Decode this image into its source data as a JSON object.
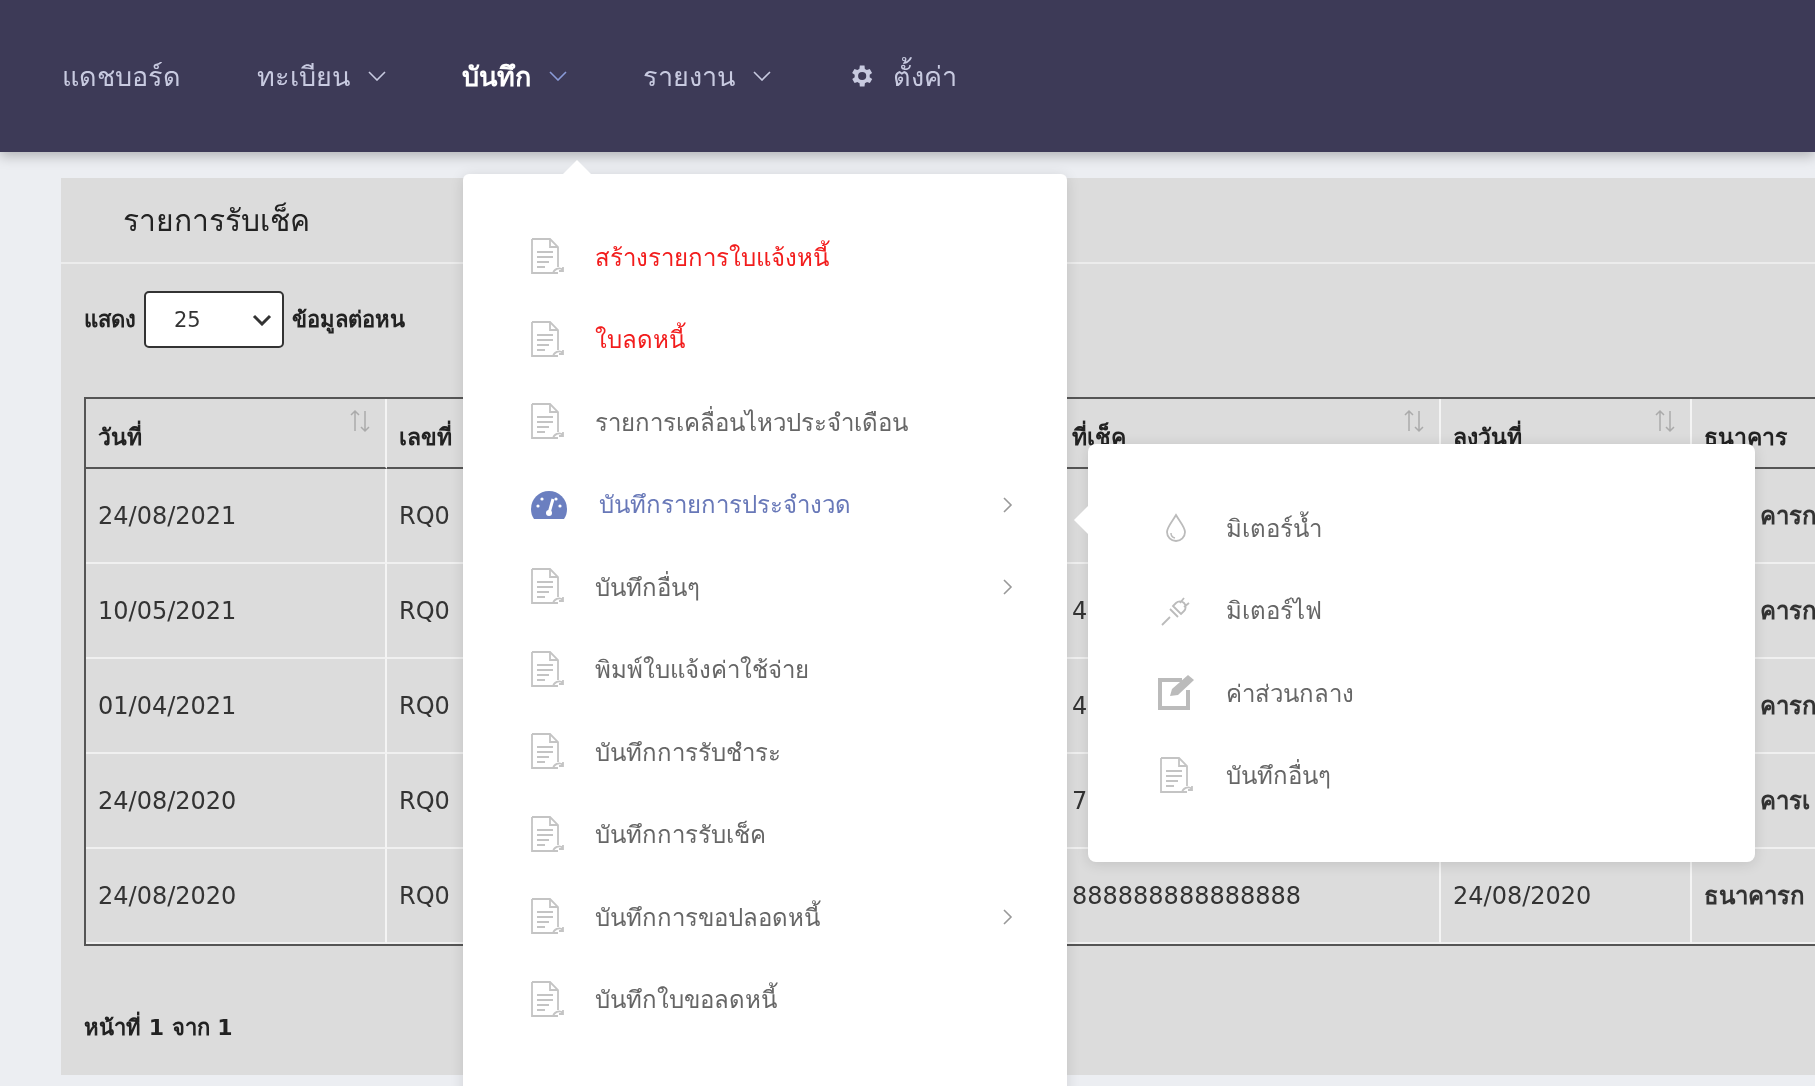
{
  "nav": {
    "items": [
      {
        "label": "แดชบอร์ด",
        "selected": false,
        "dropdown": false,
        "kind": "plain"
      },
      {
        "label": "ทะเบียน",
        "selected": false,
        "dropdown": true,
        "kind": "plain"
      },
      {
        "label": "บันทึก",
        "selected": true,
        "dropdown": true,
        "kind": "plain"
      },
      {
        "label": "รายงาน",
        "selected": false,
        "dropdown": true,
        "kind": "plain"
      },
      {
        "label": "ตั้งค่า",
        "selected": false,
        "dropdown": false,
        "kind": "gear"
      }
    ]
  },
  "page": {
    "title": "รายการรับเช็ค",
    "length_prefix": "แสดง",
    "length_value": "25",
    "length_suffix": "ข้อมูลต่อหน",
    "table": {
      "columns": [
        {
          "label": "วันที่",
          "sortable": true
        },
        {
          "label": "เลขที่"
        },
        {
          "label": "ที่เช็ค",
          "sortable": true
        },
        {
          "label": "ลงวันที่",
          "sortable": true
        },
        {
          "label": "ธนาคาร"
        }
      ],
      "rows": [
        {
          "date": "24/08/2021",
          "number": "RQ0",
          "bank": "คารก"
        },
        {
          "date": "10/05/2021",
          "number": "RQ0",
          "cheque": "4",
          "bank": "คารก"
        },
        {
          "date": "01/04/2021",
          "number": "RQ0",
          "cheque": "4",
          "bank": "คารก"
        },
        {
          "date": "24/08/2020",
          "number": "RQ0",
          "cheque": "7",
          "bank": "คารเ"
        },
        {
          "date": "24/08/2020",
          "number": "RQ0",
          "cheque": "888888888888888",
          "cheque_date": "24/08/2020",
          "bank": "ธนาคารก"
        }
      ]
    },
    "footer": "หน้าที่ 1 จาก 1"
  },
  "menu": {
    "items": [
      {
        "label": "สร้างรายการใบแจ้งหนี้",
        "kind": "document",
        "color": "#f21c1c",
        "selected": false,
        "submenu": false
      },
      {
        "label": "ใบลดหนี้",
        "kind": "document",
        "color": "#f21c1c",
        "selected": false,
        "submenu": false
      },
      {
        "label": "รายการเคลื่อนไหวประจำเดือน",
        "kind": "document",
        "color": "#666666",
        "selected": false,
        "submenu": false
      },
      {
        "label": "บันทึกรายการประจำงวด",
        "kind": "gauge",
        "selected": true,
        "submenu": true
      },
      {
        "label": "บันทึกอื่นๆ",
        "kind": "document",
        "color": "#666666",
        "selected": false,
        "submenu": true
      },
      {
        "label": "พิมพ์ใบแจ้งค่าใช้จ่าย",
        "kind": "document",
        "color": "#666666",
        "selected": false,
        "submenu": false
      },
      {
        "label": "บันทึกการรับชำระ",
        "kind": "document",
        "color": "#666666",
        "selected": false,
        "submenu": false
      },
      {
        "label": "บันทึกการรับเช็ค",
        "kind": "document",
        "color": "#666666",
        "selected": false,
        "submenu": false
      },
      {
        "label": "บันทึกการขอปลอดหนี้",
        "kind": "document",
        "color": "#666666",
        "selected": false,
        "submenu": true
      },
      {
        "label": "บันทึกใบขอลดหนี้",
        "kind": "document",
        "color": "#666666",
        "selected": false,
        "submenu": false
      }
    ]
  },
  "submenu": {
    "items": [
      {
        "label": "มิเตอร์น้ำ",
        "kind": "drop"
      },
      {
        "label": "มิเตอร์ไฟ",
        "kind": "plug"
      },
      {
        "label": "ค่าส่วนกลาง",
        "kind": "edit"
      },
      {
        "label": "บันทึกอื่นๆ",
        "kind": "document"
      }
    ]
  }
}
